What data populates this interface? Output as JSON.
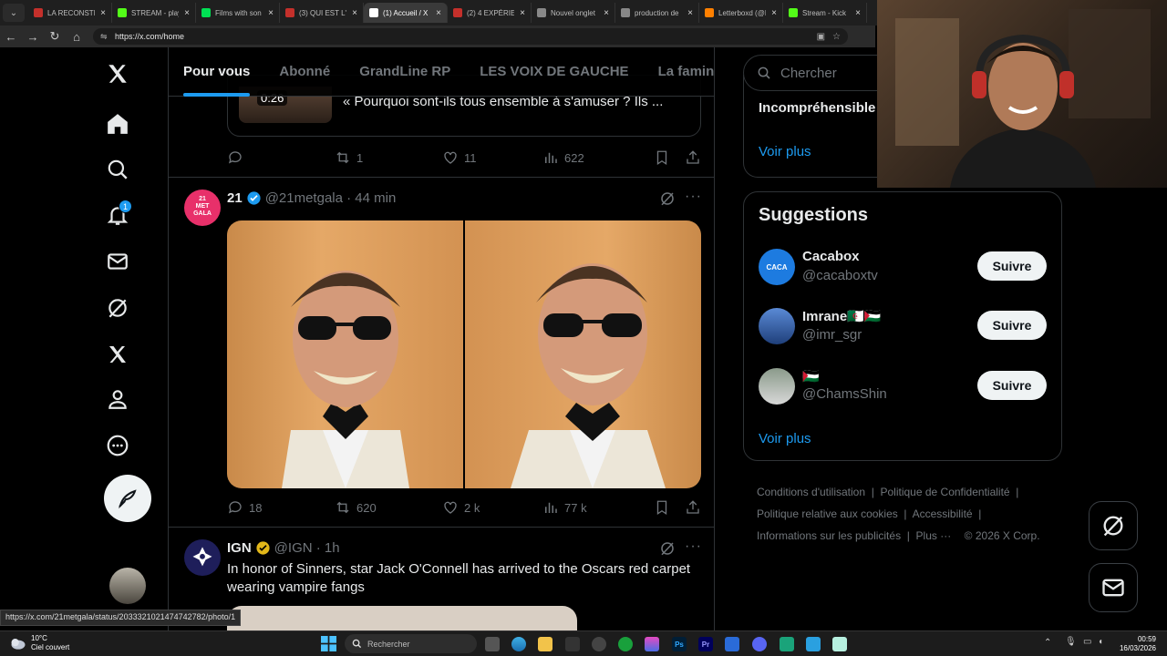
{
  "browser": {
    "tabs": [
      {
        "label": "LA RECONSTIT",
        "color": "#c4302b"
      },
      {
        "label": "STREAM - play",
        "color": "#53fc18"
      },
      {
        "label": "Films with son",
        "color": "#00e054"
      },
      {
        "label": "(3) QUI EST L'I",
        "color": "#c4302b"
      },
      {
        "label": "(1) Accueil / X",
        "color": "#ffffff"
      },
      {
        "label": "(2) 4 EXPÉRIEN",
        "color": "#c4302b"
      },
      {
        "label": "Nouvel onglet",
        "color": "#888888"
      },
      {
        "label": "production de",
        "color": "#888888"
      },
      {
        "label": "Letterboxd (@R",
        "color": "#ff8000"
      },
      {
        "label": "Stream - Kick",
        "color": "#53fc18"
      }
    ],
    "url": "https://x.com/home",
    "status_url": "https://x.com/21metgala/status/2033321021474742782/photo/1"
  },
  "nav": {
    "notif_badge": "1"
  },
  "feed_tabs": [
    "Pour vous",
    "Abonné",
    "GrandLine RP",
    "LES VOIX DE GAUCHE",
    "La famine"
  ],
  "prev_tweet": {
    "video_time": "0:26",
    "quote_text": "« Pourquoi sont-ils tous ensemble à s'amuser ? Ils ...",
    "stats": {
      "replies": "",
      "reposts": "1",
      "likes": "11",
      "views": "622"
    }
  },
  "tweet1": {
    "avatar_text": "21\nMET\nGALA",
    "name": "21",
    "handle": "@21metgala · 44 min",
    "stats": {
      "replies": "18",
      "reposts": "620",
      "likes": "2 k",
      "views": "77 k"
    }
  },
  "tweet2": {
    "name": "IGN",
    "handle": "@IGN · 1h",
    "text": "In honor of Sinners, star Jack O'Connell has arrived to the Oscars red carpet wearing vampire fangs"
  },
  "search": {
    "placeholder": "Chercher"
  },
  "trends": {
    "item": "Incompréhensible",
    "more": "Voir plus"
  },
  "suggestions": {
    "title": "Suggestions",
    "follow_label": "Suivre",
    "more": "Voir plus",
    "items": [
      {
        "name": "Cacabox",
        "handle": "@cacaboxtv"
      },
      {
        "name": "Imrane🇩🇿🇵🇸",
        "handle": "@imr_sgr"
      },
      {
        "name": "🇵🇸",
        "handle": "@ChamsShin"
      }
    ]
  },
  "footer": {
    "links": [
      "Conditions d'utilisation",
      "Politique de Confidentialité",
      "Politique relative aux cookies",
      "Accessibilité",
      "Informations sur les publicités",
      "Plus ···",
      "© 2026 X Corp."
    ]
  },
  "taskbar": {
    "weather_temp": "10°C",
    "weather_desc": "Ciel couvert",
    "search_placeholder": "Rechercher",
    "time": "00:59",
    "date": "16/03/2026"
  }
}
